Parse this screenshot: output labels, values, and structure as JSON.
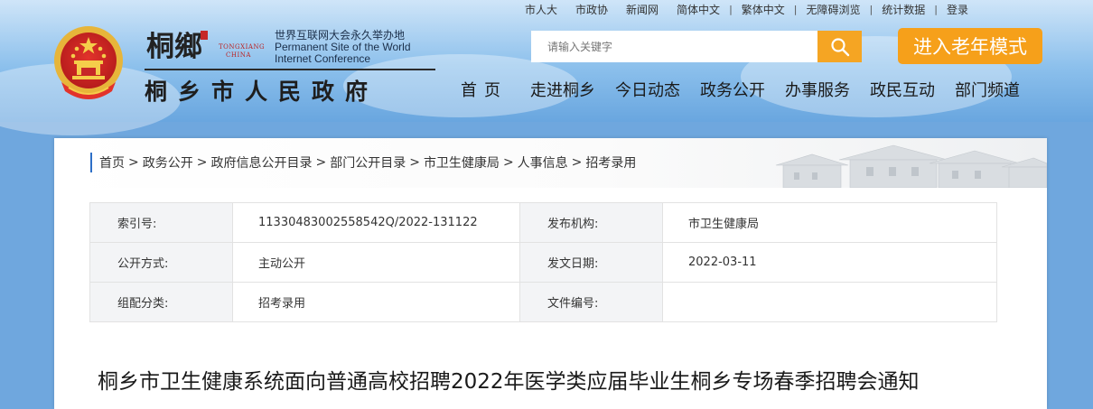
{
  "top_links": [
    "市人大",
    "市政协",
    "新闻网",
    "简体中文",
    "繁体中文",
    "无障碍浏览",
    "统计数据"
  ],
  "login_label": "登录",
  "logo": {
    "calligraphy": "桐鄉",
    "pinyin_line1": "TONGXIANG",
    "pinyin_line2": "CHINA",
    "slogan_cn": "世界互联网大会永久举办地",
    "slogan_en_line1": "Permanent Site of the World",
    "slogan_en_line2": "Internet Conference",
    "gov_title": "桐乡市人民政府"
  },
  "search": {
    "placeholder": "请输入关键字"
  },
  "elder_mode_label": "进入老年模式",
  "nav": [
    "首页",
    "走进桐乡",
    "今日动态",
    "政务公开",
    "办事服务",
    "政民互动",
    "部门频道"
  ],
  "breadcrumb": [
    "首页",
    "政务公开",
    "政府信息公开目录",
    "部门公开目录",
    "市卫生健康局",
    "人事信息",
    "招考录用"
  ],
  "meta": {
    "index_label": "索引号:",
    "index_value": "11330483002558542Q/2022-131122",
    "publisher_label": "发布机构:",
    "publisher_value": "市卫生健康局",
    "method_label": "公开方式:",
    "method_value": "主动公开",
    "date_label": "发文日期:",
    "date_value": "2022-03-11",
    "category_label": "组配分类:",
    "category_value": "招考录用",
    "docno_label": "文件编号:",
    "docno_value": ""
  },
  "doc_title": "桐乡市卫生健康系统面向普通高校招聘2022年医学类应届毕业生桐乡专场春季招聘会通知",
  "colors": {
    "accent_orange": "#f6a01a",
    "nav_blue": "#69a6df",
    "crumb_bar": "#2d6fc7"
  }
}
